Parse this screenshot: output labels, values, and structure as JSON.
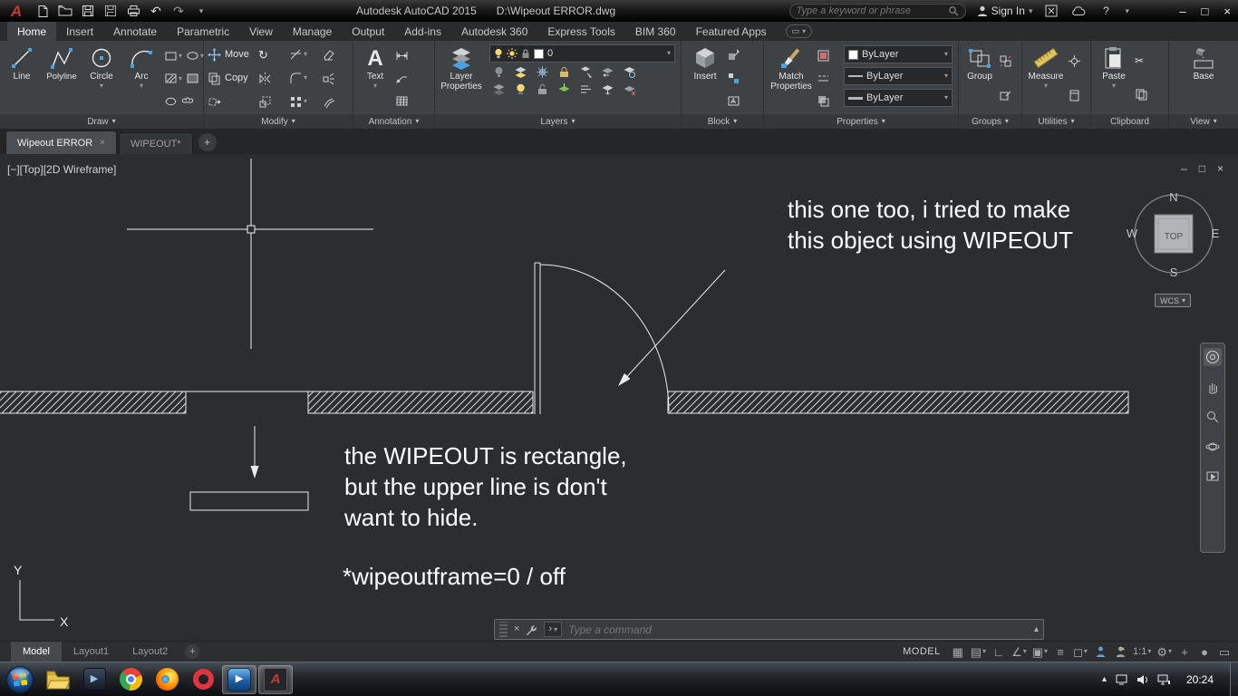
{
  "colors": {
    "autocad_red": "#c33a31",
    "accent_blue": "#4aa3e0",
    "viewport_bg": "#2b2d2f",
    "status_blue": "#5ba3d4"
  },
  "icons": {
    "caret": "▾",
    "up_arrow": "▴",
    "plus": "+",
    "close": "×",
    "minimize": "–",
    "restore": "□",
    "help": "?",
    "undo": "↶",
    "redo": "↷",
    "grid": "▦",
    "snap": "▤",
    "ortho": "∟",
    "polar": "∠",
    "osnap": "▣",
    "lineweight": "≡",
    "selection": "◻",
    "gear": "⚙",
    "perf_circle": "●",
    "clean_screen": "▭",
    "text_tool": "A",
    "autocad_a": "A",
    "play": "▶",
    "prompt": "›",
    "rotate": "↻",
    "scissors": "✂",
    "tray_up": "▴"
  },
  "titlebar": {
    "app_title": "Autodesk AutoCAD 2015",
    "doc_title": "D:\\Wipeout ERROR.dwg",
    "search_placeholder": "Type a keyword or phrase",
    "sign_in_label": "Sign In"
  },
  "ribbon": {
    "tabs": [
      "Home",
      "Insert",
      "Annotate",
      "Parametric",
      "View",
      "Manage",
      "Output",
      "Add-ins",
      "Autodesk 360",
      "Express Tools",
      "BIM 360",
      "Featured Apps"
    ],
    "draw": {
      "label": "Draw",
      "line": "Line",
      "polyline": "Polyline",
      "circle": "Circle",
      "arc": "Arc"
    },
    "modify": {
      "label": "Modify",
      "move": "Move",
      "copy": "Copy"
    },
    "annotation": {
      "label": "Annotation",
      "text": "Text"
    },
    "layers": {
      "label": "Layers",
      "layer_properties": "Layer Properties",
      "current_layer": "0"
    },
    "block": {
      "label": "Block",
      "insert": "Insert"
    },
    "properties": {
      "label": "Properties",
      "match_properties": "Match Properties",
      "color": "ByLayer",
      "linetype": "ByLayer",
      "lineweight": "ByLayer"
    },
    "groups": {
      "label": "Groups",
      "group": "Group"
    },
    "utilities": {
      "label": "Utilities",
      "measure": "Measure"
    },
    "clipboard": {
      "label": "Clipboard",
      "paste": "Paste"
    },
    "view": {
      "label": "View",
      "base": "Base"
    }
  },
  "file_tabs": [
    "Wipeout ERROR",
    "WIPEOUT*"
  ],
  "viewport": {
    "label": "[−][Top][2D Wireframe]",
    "viewcube": {
      "n": "N",
      "s": "S",
      "e": "E",
      "w": "W",
      "top": "TOP",
      "wcs": "WCS"
    },
    "ucs": {
      "x": "X",
      "y": "Y"
    },
    "notes": {
      "note1_l1": "this one too, i tried to make",
      "note1_l2": "this object using WIPEOUT",
      "note2_l1": "the WIPEOUT is rectangle,",
      "note2_l2": "but the upper line is don't",
      "note2_l3": "want to hide.",
      "note3": "*wipeoutframe=0 / off"
    }
  },
  "command_line": {
    "placeholder": "Type a command"
  },
  "layout_bar": {
    "tabs": [
      "Model",
      "Layout1",
      "Layout2"
    ]
  },
  "status_bar": {
    "model": "MODEL",
    "scale": "1:1"
  },
  "taskbar": {
    "time": "20:24"
  }
}
